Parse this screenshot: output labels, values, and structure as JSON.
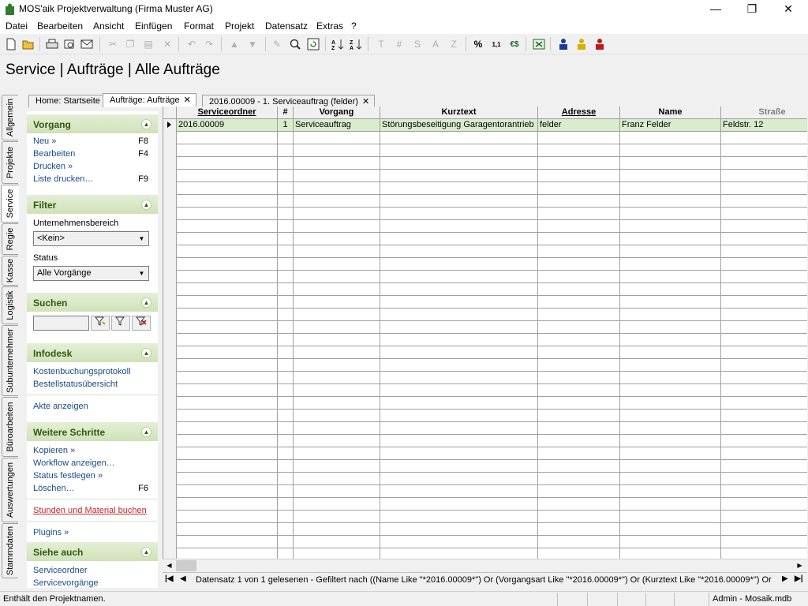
{
  "window": {
    "title": "MOS'aik Projektverwaltung (Firma Muster AG)",
    "min": "—",
    "max": "❐",
    "close": "✕"
  },
  "menu": [
    "Datei",
    "Bearbeiten",
    "Ansicht",
    "Einfügen",
    "Format",
    "Projekt",
    "Datensatz",
    "Extras",
    "?"
  ],
  "toolbar": {
    "percent": "%",
    "calc": "1,1",
    "euro": "€$"
  },
  "page_title": "Service | Aufträge | Alle Aufträge",
  "side_tabs": [
    "Allgemein",
    "Projekte",
    "Service",
    "Regie",
    "Kasse",
    "Logistik",
    "Subunternehmer",
    "Büroarbeiten",
    "Auswertungen",
    "Stammdaten"
  ],
  "active_side_tab": "Service",
  "doc_tabs": [
    {
      "label": "Home: Startseite",
      "closable": false
    },
    {
      "label": "Aufträge: Aufträge",
      "closable": true
    },
    {
      "label": "2016.00009 - 1. Serviceauftrag (felder)",
      "closable": true
    }
  ],
  "panel": {
    "vorgang": {
      "title": "Vorgang",
      "items": [
        {
          "label": "Neu »",
          "key": "F8"
        },
        {
          "label": "Bearbeiten",
          "key": "F4"
        },
        {
          "label": "Drucken »",
          "key": ""
        },
        {
          "label": "Liste drucken…",
          "key": "F9"
        }
      ]
    },
    "filter": {
      "title": "Filter",
      "unternehmensbereich_label": "Unternehmensbereich",
      "unternehmensbereich_value": "<Kein>",
      "status_label": "Status",
      "status_value": "Alle Vorgänge"
    },
    "suchen": {
      "title": "Suchen",
      "value": ""
    },
    "infodesk": {
      "title": "Infodesk",
      "items": [
        "Kostenbuchungsprotokoll",
        "Bestellstatusübersicht",
        "Akte anzeigen"
      ]
    },
    "weitere": {
      "title": "Weitere Schritte",
      "items": [
        {
          "label": "Kopieren »",
          "key": ""
        },
        {
          "label": "Workflow anzeigen…",
          "key": ""
        },
        {
          "label": "Status festlegen »",
          "key": ""
        },
        {
          "label": "Löschen…",
          "key": "F6"
        }
      ],
      "stunden": "Stunden und Material buchen",
      "plugins": "Plugins »"
    },
    "siehe": {
      "title": "Siehe auch",
      "items": [
        "Serviceordner",
        "Servicevorgänge"
      ]
    }
  },
  "grid": {
    "columns": [
      "Serviceordner",
      "#",
      "Vorgang",
      "Kurztext",
      "Adresse",
      "Name",
      "Straße"
    ],
    "rows": [
      [
        "2016.00009",
        "1",
        "Serviceauftrag",
        "Störungsbeseitigung Garagentorantrieb",
        "felder",
        "Franz Felder",
        "Feldstr. 12"
      ]
    ],
    "empty_rows": 34
  },
  "navbar": {
    "text": "Datensatz 1 von 1 gelesenen - Gefiltert nach  ((Name Like \"*2016.00009*\") Or (Vorgangsart Like \"*2016.00009*\") Or (Kurztext Like \"*2016.00009*\") Or"
  },
  "status": {
    "left": "Enthält den Projektnamen.",
    "right": "Admin - Mosaik.mdb"
  },
  "colors": {
    "accent_green": "#cfe2b8",
    "selected_row": "#d9eccc",
    "link": "#1a4a8a",
    "red_link": "#c0282b"
  }
}
